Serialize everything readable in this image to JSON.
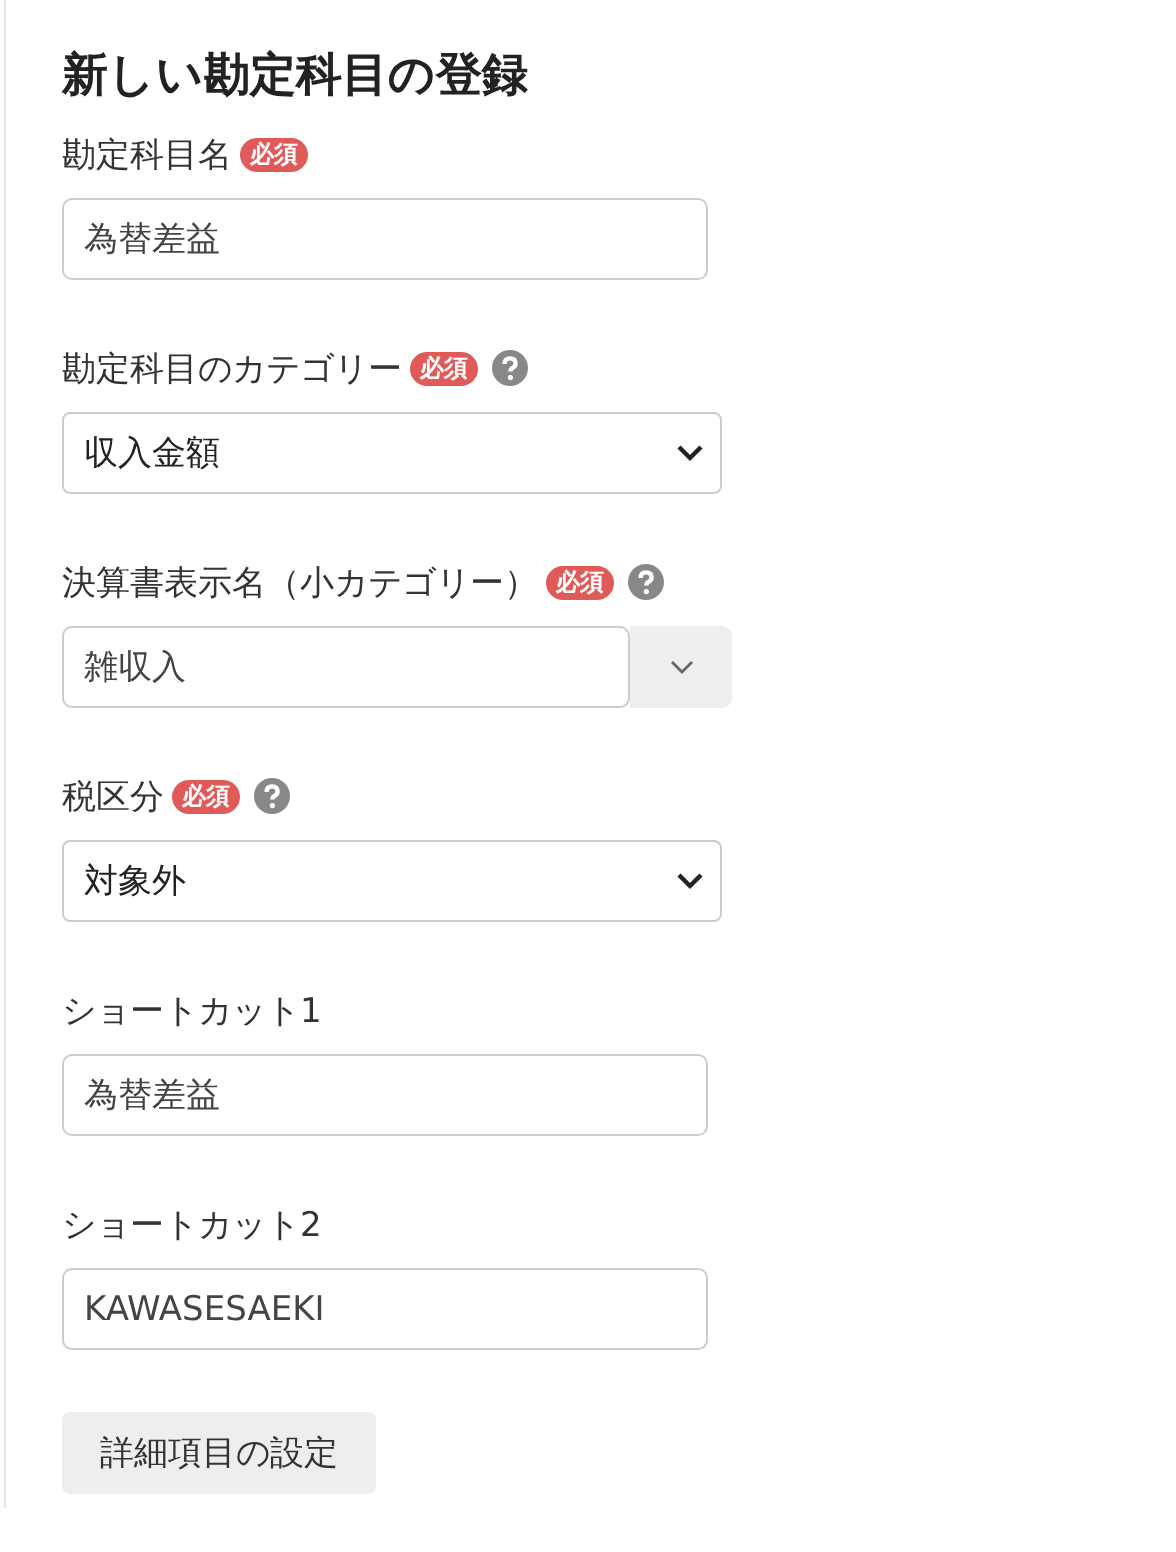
{
  "title": "新しい勘定科目の登録",
  "fields": [
    {
      "kind": "text",
      "label": "勘定科目名",
      "required": true,
      "required_badge": "必須",
      "help": false,
      "value": "為替差益"
    },
    {
      "kind": "select",
      "label": "勘定科目のカテゴリー",
      "required": true,
      "required_badge": "必須",
      "help": true,
      "value": "収入金額"
    },
    {
      "kind": "combo",
      "label": "決算書表示名（小カテゴリー）",
      "required": true,
      "required_badge": "必須",
      "help": true,
      "value": "雑収入"
    },
    {
      "kind": "select",
      "label": "税区分",
      "required": true,
      "required_badge": "必須",
      "help": true,
      "value": "対象外"
    },
    {
      "kind": "text",
      "label": "ショートカット1",
      "required": false,
      "help": false,
      "value": "為替差益"
    },
    {
      "kind": "text",
      "label": "ショートカット2",
      "required": false,
      "help": false,
      "value": "KAWASESAEKI"
    }
  ],
  "button": "詳細項目の設定"
}
